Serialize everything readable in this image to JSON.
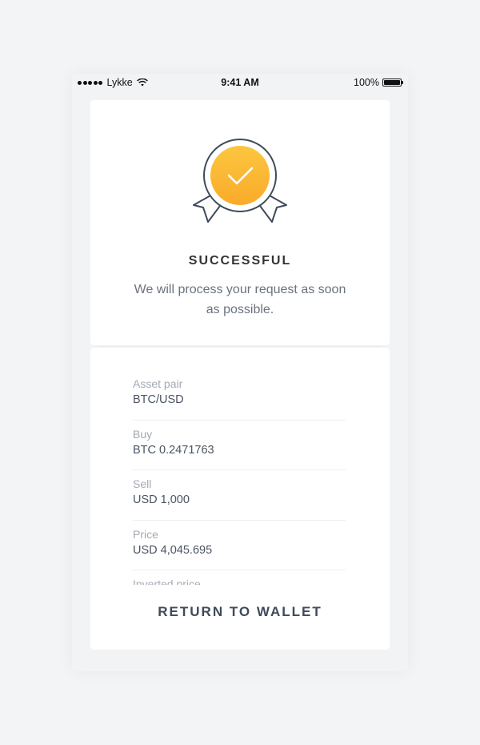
{
  "status_bar": {
    "carrier": "Lykke",
    "time": "9:41 AM",
    "battery": "100%"
  },
  "result": {
    "title": "SUCCESSFUL",
    "message": "We will process your request as soon as possible."
  },
  "details": [
    {
      "label": "Asset pair",
      "value": "BTC/USD"
    },
    {
      "label": "Buy",
      "value": "BTC 0.2471763"
    },
    {
      "label": "Sell",
      "value": "USD 1,000"
    },
    {
      "label": "Price",
      "value": "USD 4,045.695"
    },
    {
      "label": "Inverted price",
      "value": ""
    }
  ],
  "actions": {
    "return_label": "RETURN TO WALLET"
  },
  "colors": {
    "medal_gold": "#fbb72c",
    "medal_outline": "#3f4a5a",
    "text_dark": "#333333",
    "text_muted": "#6b7280"
  }
}
